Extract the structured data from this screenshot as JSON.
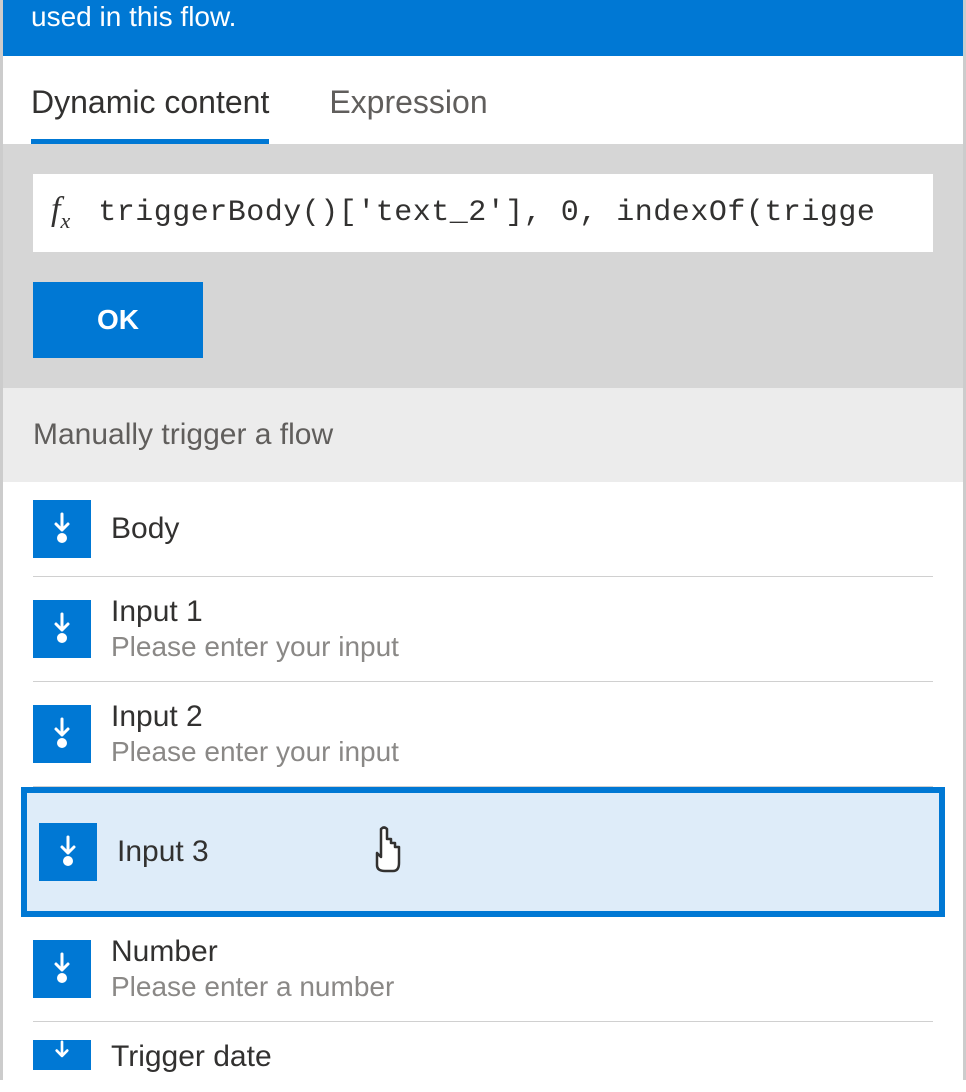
{
  "banner": {
    "text": "used in this flow."
  },
  "tabs": {
    "dynamic": "Dynamic content",
    "expression": "Expression"
  },
  "expression": {
    "fx_label": "fx",
    "value": "triggerBody()['text_2'], 0, indexOf(trigge",
    "ok_label": "OK"
  },
  "section": {
    "title": "Manually trigger a flow"
  },
  "items": [
    {
      "title": "Body",
      "desc": ""
    },
    {
      "title": "Input 1",
      "desc": "Please enter your input"
    },
    {
      "title": "Input 2",
      "desc": "Please enter your input"
    },
    {
      "title": "Input 3",
      "desc": ""
    },
    {
      "title": "Number",
      "desc": "Please enter a number"
    },
    {
      "title": "Trigger date",
      "desc": ""
    }
  ]
}
